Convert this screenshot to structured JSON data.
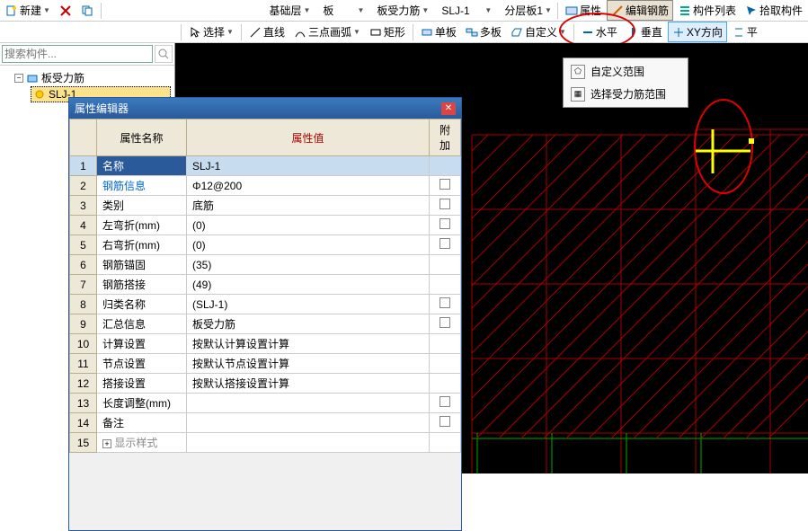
{
  "toolbar1": {
    "new_label": "新建",
    "base_layer": "基础层",
    "cat": "板",
    "subcat": "板受力筋",
    "member": "SLJ-1",
    "layer": "分层板1",
    "props": "属性",
    "edit_rebar": "编辑钢筋",
    "member_list": "构件列表",
    "pick_member": "拾取构件"
  },
  "toolbar2": {
    "select": "选择",
    "line": "直线",
    "arc3": "三点画弧",
    "rect": "矩形",
    "single_slab": "单板",
    "multi_slab": "多板",
    "custom": "自定义",
    "horizontal": "水平",
    "vertical": "垂直",
    "xy_dir": "XY方向",
    "parallel": "平"
  },
  "search": {
    "placeholder": "搜索构件..."
  },
  "tree": {
    "root": "板受力筋",
    "child": "SLJ-1"
  },
  "prop": {
    "title": "属性编辑器",
    "col_name": "属性名称",
    "col_value": "属性值",
    "col_attach": "附加",
    "rows": [
      {
        "n": "1",
        "name": "名称",
        "value": "SLJ-1",
        "sel": true
      },
      {
        "n": "2",
        "name": "钢筋信息",
        "value": "Φ12@200",
        "blue": true,
        "chk": true
      },
      {
        "n": "3",
        "name": "类别",
        "value": "底筋",
        "chk": true
      },
      {
        "n": "4",
        "name": "左弯折(mm)",
        "value": "(0)",
        "chk": true
      },
      {
        "n": "5",
        "name": "右弯折(mm)",
        "value": "(0)",
        "chk": true
      },
      {
        "n": "6",
        "name": "钢筋锚固",
        "value": "(35)"
      },
      {
        "n": "7",
        "name": "钢筋搭接",
        "value": "(49)"
      },
      {
        "n": "8",
        "name": "归类名称",
        "value": "(SLJ-1)",
        "chk": true
      },
      {
        "n": "9",
        "name": "汇总信息",
        "value": "板受力筋",
        "chk": true
      },
      {
        "n": "10",
        "name": "计算设置",
        "value": "按默认计算设置计算"
      },
      {
        "n": "11",
        "name": "节点设置",
        "value": "按默认节点设置计算"
      },
      {
        "n": "12",
        "name": "搭接设置",
        "value": "按默认搭接设置计算"
      },
      {
        "n": "13",
        "name": "长度调整(mm)",
        "value": "",
        "chk": true
      },
      {
        "n": "14",
        "name": "备注",
        "value": "",
        "chk": true
      },
      {
        "n": "15",
        "name": "显示样式",
        "value": "",
        "gray": true,
        "plus": true
      }
    ]
  },
  "ctx": {
    "item1": "自定义范围",
    "item2": "选择受力筋范围"
  }
}
